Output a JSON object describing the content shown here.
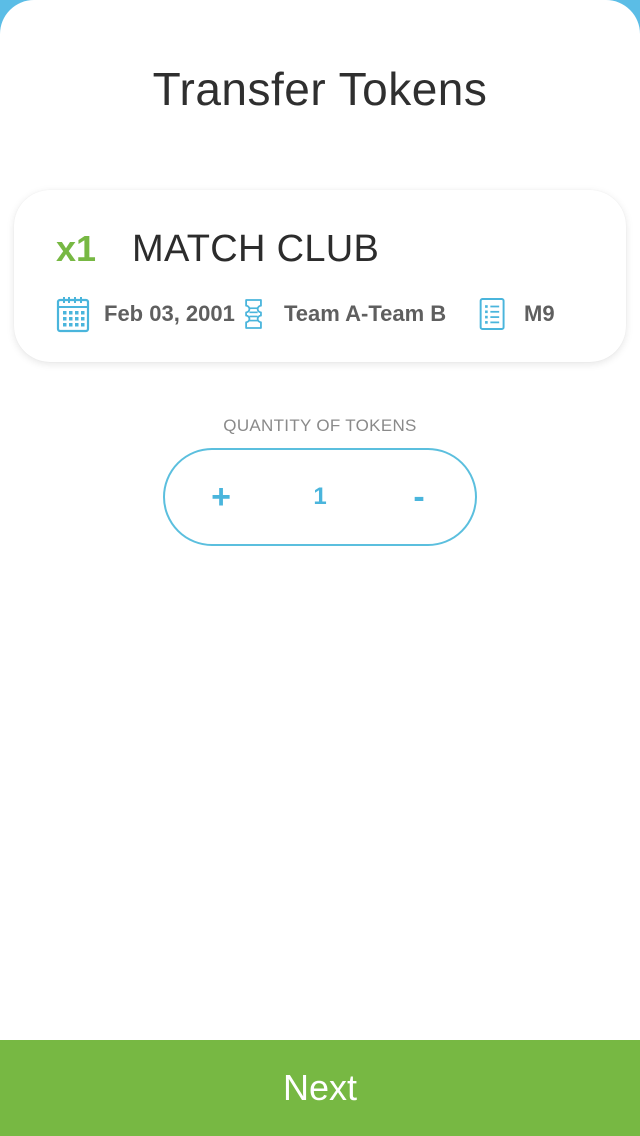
{
  "header": {
    "title": "Transfer Tokens"
  },
  "event": {
    "quantity_badge": "x1",
    "name": "MATCH CLUB",
    "date": "Feb 03, 2001",
    "teams": "Team A-Team B",
    "code": "M9"
  },
  "quantity": {
    "label": "QUANTITY OF TOKENS",
    "increment_label": "+",
    "value": "1",
    "decrement_label": "-"
  },
  "footer": {
    "next_label": "Next"
  },
  "colors": {
    "accent_blue": "#5bbfde",
    "accent_green": "#77b843"
  },
  "icons": {
    "date": "calendar-icon",
    "teams": "ticket-icon",
    "code": "list-icon"
  }
}
